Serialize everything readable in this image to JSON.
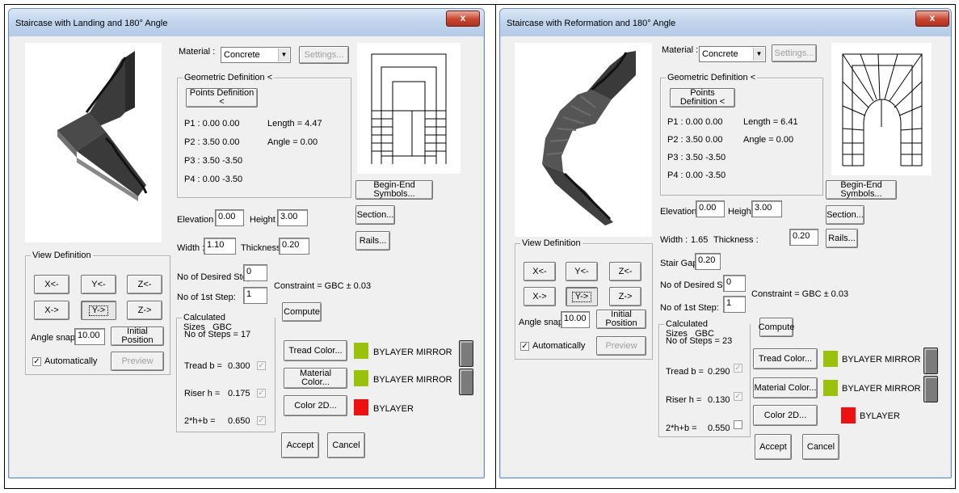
{
  "left_dialog": {
    "title": "Staircase with Landing and 180° Angle",
    "close": "x",
    "material_label": "Material :",
    "material_value": "Concrete",
    "settings_label": "Settings...",
    "geom_group": "Geometric Definition <",
    "points_button": "Points Definition <",
    "p1": "P1 :  0.00 0.00",
    "p2": "P2 :  3.50 0.00",
    "p3": "P3 :  3.50 -3.50",
    "p4": "P4 :  0.00 -3.50",
    "length": "Length = 4.47",
    "angle": "Angle = 0.00",
    "begin_end": "Begin-End Symbols...",
    "section": "Section...",
    "rails": "Rails...",
    "elevation_label": "Elevation :",
    "elevation_value": "0.00",
    "height_label": "Height :",
    "height_value": "3.00",
    "width_label": "Width :",
    "width_value": "1.10",
    "thickness_label": "Thickness :",
    "thickness_value": "0.20",
    "view_group": "View Definition",
    "x_minus": "X<-",
    "y_minus": "Y<-",
    "z_minus": "Z<-",
    "x_plus": "X->",
    "y_plus": "Y->",
    "z_plus": "Z->",
    "angle_snap_label": "Angle snap:",
    "angle_snap_value": "10.00",
    "initial_position": "Initial Position",
    "automatically": "Automatically",
    "preview": "Preview",
    "desired_steps_label": "No of Desired Steps :",
    "desired_steps_value": "0",
    "first_step_label": "No of 1st Step:",
    "first_step_value": "1",
    "constraint": "Constraint = GBC ±  0.03",
    "calc_group": "Calculated Sizes",
    "gbc": "GBC",
    "compute": "Compute",
    "num_steps": "No of Steps = 17",
    "tread_label": "Tread b =",
    "tread_value": "0.300",
    "riser_label": "Riser h =",
    "riser_value": "0.175",
    "formula_label": "2*h+b =",
    "formula_value": "0.650",
    "tread_color_btn": "Tread Color...",
    "material_color_btn": "Material Color...",
    "color2d_btn": "Color 2D...",
    "tread_color_text": "BYLAYER MIRROR",
    "material_color_text": "BYLAYER MIRROR",
    "color2d_text": "BYLAYER",
    "accept": "Accept",
    "cancel": "Cancel"
  },
  "right_dialog": {
    "title": "Staircase with Reformation and 180° Angle",
    "close": "x",
    "material_label": "Material :",
    "material_value": "Concrete",
    "settings_label": "Settings...",
    "geom_group": "Geometric Definition <",
    "points_button": "Points Definition <",
    "p1": "P1 :  0.00 0.00",
    "p2": "P2 :  3.50 0.00",
    "p3": "P3 :  3.50 -3.50",
    "p4": "P4 :  0.00 -3.50",
    "length": "Length = 6.41",
    "angle": "Angle = 0.00",
    "begin_end": "Begin-End Symbols...",
    "section": "Section...",
    "rails": "Rails...",
    "elevation_label": "Elevation :",
    "elevation_value": "0.00",
    "height_label": "Height :",
    "height_value": "3.00",
    "width_label": "Width :",
    "width_value": "1.65",
    "thickness_label": "Thickness :",
    "thickness_value": "0.20",
    "stair_gap_label": "Stair Gap :",
    "stair_gap_value": "0.20",
    "view_group": "View Definition",
    "x_minus": "X<-",
    "y_minus": "Y<-",
    "z_minus": "Z<-",
    "x_plus": "X->",
    "y_plus": "Y->",
    "z_plus": "Z->",
    "angle_snap_label": "Angle snap:",
    "angle_snap_value": "10.00",
    "initial_position": "Initial Position",
    "automatically": "Automatically",
    "preview": "Preview",
    "desired_steps_label": "No of Desired Steps :",
    "desired_steps_value": "0",
    "first_step_label": "No of 1st Step:",
    "first_step_value": "1",
    "constraint": "Constraint = GBC ±  0.03",
    "calc_group": "Calculated Sizes",
    "gbc": "GBC",
    "compute": "Compute",
    "num_steps": "No of Steps = 23",
    "tread_label": "Tread b =",
    "tread_value": "0.290",
    "riser_label": "Riser h =",
    "riser_value": "0.130",
    "formula_label": "2*h+b =",
    "formula_value": "0.550",
    "tread_color_btn": "Tread Color...",
    "material_color_btn": "Material Color...",
    "color2d_btn": "Color 2D...",
    "tread_color_text": "BYLAYER MIRROR",
    "material_color_text": "BYLAYER MIRROR",
    "color2d_text": "BYLAYER",
    "accept": "Accept",
    "cancel": "Cancel"
  },
  "colors": {
    "mirror_swatch": "#9bc20a",
    "bylayer_swatch": "#ee1111"
  }
}
